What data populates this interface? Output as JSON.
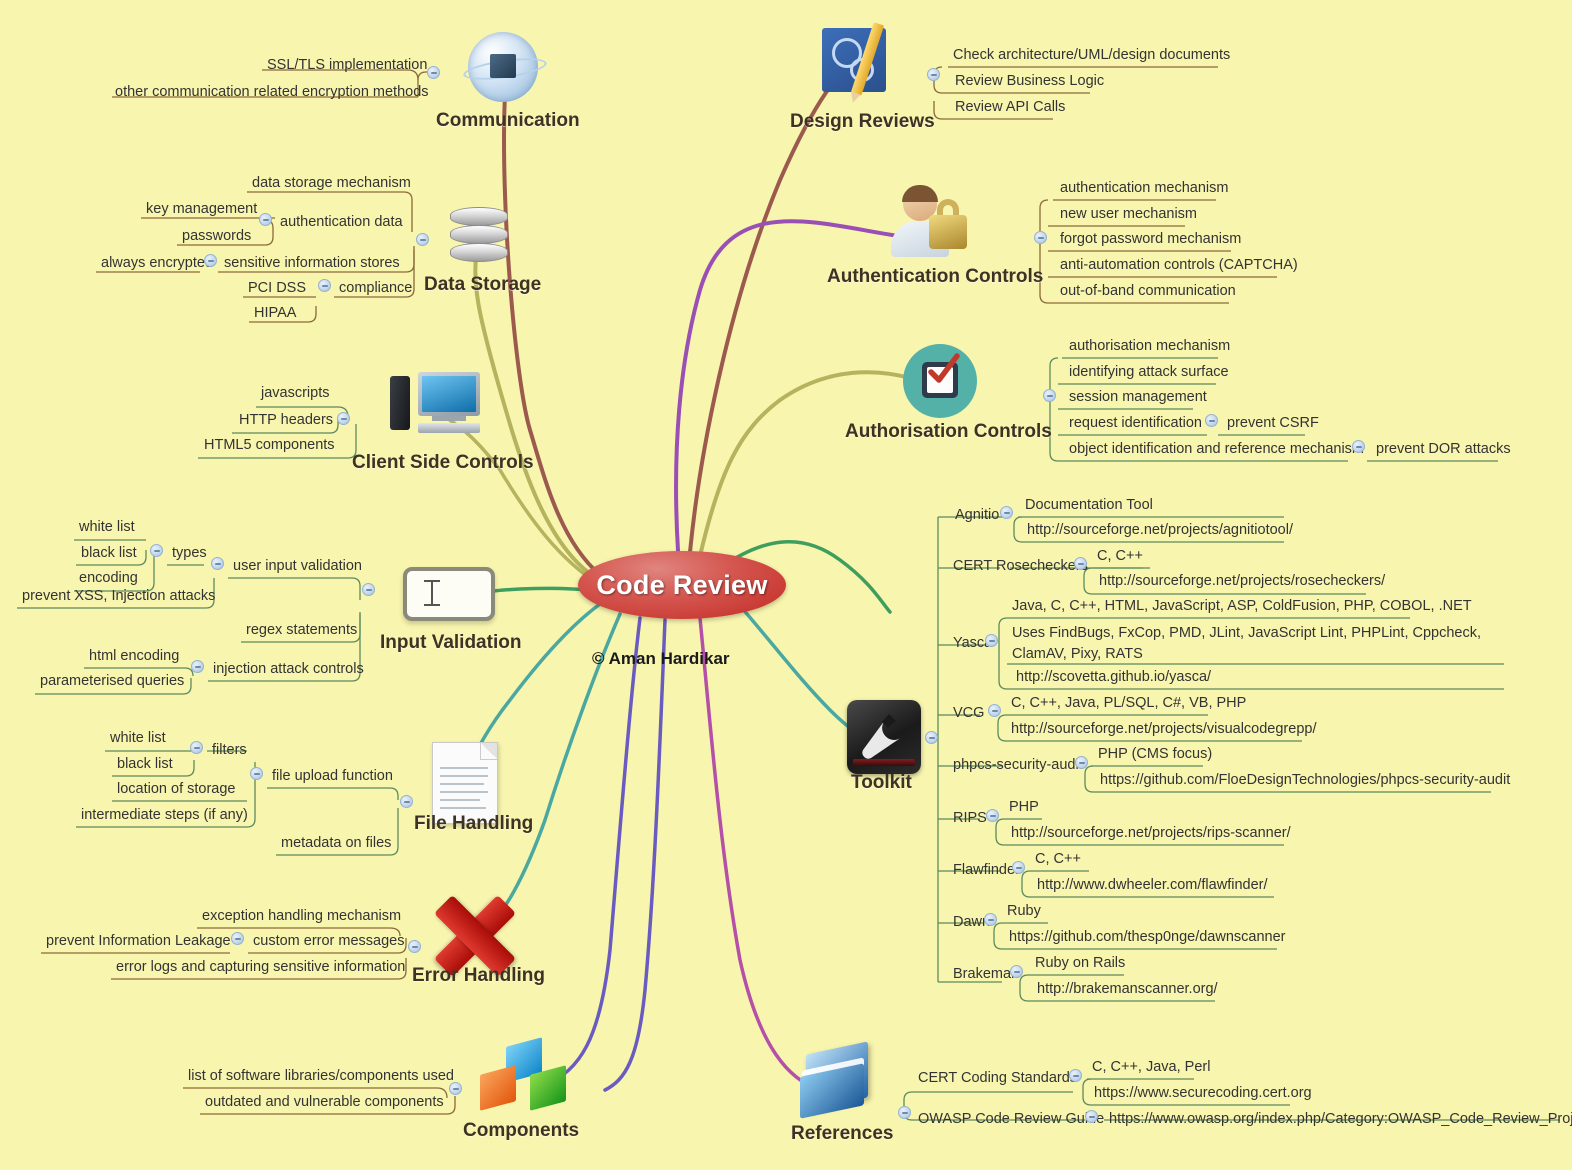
{
  "root": {
    "title": "Code Review",
    "copyright": "© Aman Hardikar"
  },
  "branches": {
    "communication": {
      "title": "Communication",
      "icon": "globe-server-icon",
      "children": [
        "SSL/TLS implementation",
        "other communication related encryption methods"
      ]
    },
    "data_storage": {
      "title": "Data Storage",
      "icon": "database-icon",
      "children": [
        {
          "label": "data storage mechanism"
        },
        {
          "label": "authentication data",
          "children": [
            "key management",
            "passwords"
          ]
        },
        {
          "label": "sensitive information stores",
          "children": [
            "always encrypted"
          ]
        },
        {
          "label": "compliance",
          "children": [
            "PCI DSS",
            "HIPAA"
          ]
        }
      ]
    },
    "client_side_controls": {
      "title": "Client Side Controls",
      "icon": "desktop-computer-icon",
      "children": [
        "javascripts",
        "HTTP headers",
        "HTML5 components"
      ]
    },
    "input_validation": {
      "title": "Input Validation",
      "icon": "text-input-icon",
      "children": [
        {
          "label": "user input validation",
          "sub_label": "types",
          "sub_children": [
            "white list",
            "black list",
            "encoding"
          ],
          "extra": "prevent XSS, Injection attacks"
        },
        {
          "label": "regex statements"
        },
        {
          "label": "injection attack controls",
          "children": [
            "html encoding",
            "parameterised queries"
          ]
        }
      ]
    },
    "file_handling": {
      "title": "File Handling",
      "icon": "document-icon",
      "children": [
        {
          "label": "file upload function",
          "sub_label": "filters",
          "sub_children": [
            "white list",
            "black list"
          ],
          "extra": [
            "location of storage",
            "intermediate steps (if any)"
          ]
        },
        {
          "label": "metadata on files"
        }
      ]
    },
    "error_handling": {
      "title": "Error Handling",
      "icon": "red-cross-icon",
      "children": [
        {
          "label": "exception handling mechanism"
        },
        {
          "label": "custom error messages",
          "children": [
            "prevent Information Leakage"
          ]
        },
        {
          "label": "error logs and capturing sensitive information"
        }
      ]
    },
    "components": {
      "title": "Components",
      "icon": "cubes-icon",
      "children": [
        "list of software libraries/components used",
        "outdated and vulnerable components"
      ]
    },
    "design_reviews": {
      "title": "Design Reviews",
      "icon": "blueprint-pencil-icon",
      "children": [
        "Check architecture/UML/design documents",
        "Review Business Logic",
        "Review API Calls"
      ]
    },
    "authentication_controls": {
      "title": "Authentication Controls",
      "icon": "user-padlock-icon",
      "children": [
        "authentication mechanism",
        "new user mechanism",
        "forgot password mechanism",
        "anti-automation controls (CAPTCHA)",
        "out-of-band communication"
      ]
    },
    "authorisation_controls": {
      "title": "Authorisation Controls",
      "icon": "checkbox-circle-icon",
      "children": [
        {
          "label": "authorisation mechanism"
        },
        {
          "label": "identifying attack surface"
        },
        {
          "label": "session management"
        },
        {
          "label": "request identification",
          "child": "prevent CSRF"
        },
        {
          "label": "object identification and reference mechanism",
          "child": "prevent DOR attacks"
        }
      ]
    },
    "toolkit": {
      "title": "Toolkit",
      "icon": "wrench-icon",
      "tools": [
        {
          "name": "Agnitio",
          "langs": "Documentation Tool",
          "url": "http://sourceforge.net/projects/agnitiotool/"
        },
        {
          "name": "CERT Rosecheckers",
          "langs": "C, C++",
          "url": "http://sourceforge.net/projects/rosecheckers/"
        },
        {
          "name": "Yasca",
          "langs": "Java, C, C++, HTML, JavaScript, ASP, ColdFusion, PHP, COBOL, .NET",
          "uses": "Uses FindBugs, FxCop, PMD, JLint, JavaScript Lint, PHPLint, Cppcheck, ClamAV, Pixy, RATS",
          "url": "http://scovetta.github.io/yasca/"
        },
        {
          "name": "VCG",
          "langs": "C, C++, Java, PL/SQL, C#, VB, PHP",
          "url": "http://sourceforge.net/projects/visualcodegrepp/"
        },
        {
          "name": "phpcs-security-audit",
          "langs": "PHP (CMS focus)",
          "url": "https://github.com/FloeDesignTechnologies/phpcs-security-audit"
        },
        {
          "name": "RIPS",
          "langs": "PHP",
          "url": "http://sourceforge.net/projects/rips-scanner/"
        },
        {
          "name": "Flawfinder",
          "langs": "C, C++",
          "url": "http://www.dwheeler.com/flawfinder/"
        },
        {
          "name": "Dawn",
          "langs": "Ruby",
          "url": "https://github.com/thesp0nge/dawnscanner"
        },
        {
          "name": "Brakeman",
          "langs": "Ruby on Rails",
          "url": "http://brakemanscanner.org/"
        }
      ]
    },
    "references": {
      "title": "References",
      "icon": "book-icon",
      "items": [
        {
          "name": "CERT Coding Standards",
          "langs": "C, C++, Java, Perl",
          "url": "https://www.securecoding.cert.org"
        },
        {
          "name": "OWASP Code Review Guide",
          "url": "https://www.owasp.org/index.php/Category:OWASP_Code_Review_Project"
        }
      ]
    }
  },
  "colors": {
    "background": "#f8f5ae",
    "root_fill": "#c32a24",
    "branch_olive": "#b5b35e",
    "branch_brown": "#9c5a4e",
    "branch_purple": "#9a4fb5",
    "branch_green": "#3f9e5d",
    "branch_teal": "#4aa8a0",
    "branch_violet": "#6a5bc0",
    "branch_magenta": "#b450a8"
  }
}
